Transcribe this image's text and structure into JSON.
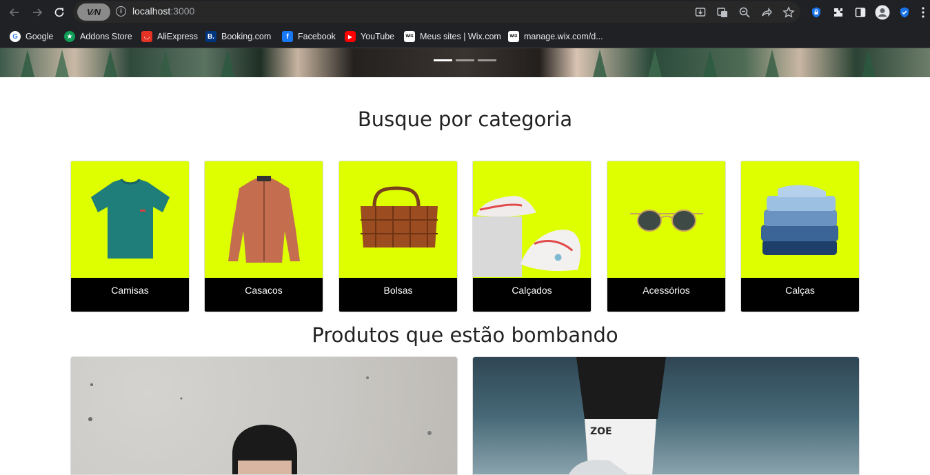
{
  "browser": {
    "url_host": "localhost",
    "url_port": ":3000",
    "vpn_label": "V⁄N",
    "bookmarks": [
      {
        "label": "Google",
        "icon": "google-icon",
        "color": "#ffffff"
      },
      {
        "label": "Addons Store",
        "icon": "addons-store-icon",
        "color": "#0f9d58"
      },
      {
        "label": "AliExpress",
        "icon": "aliexpress-icon",
        "color": "#e43225"
      },
      {
        "label": "Booking.com",
        "icon": "booking-icon",
        "color": "#003580"
      },
      {
        "label": "Facebook",
        "icon": "facebook-icon",
        "color": "#1877f2"
      },
      {
        "label": "YouTube",
        "icon": "youtube-icon",
        "color": "#ff0000"
      },
      {
        "label": "Meus sites | Wix.com",
        "icon": "wix-icon",
        "color": "#ffffff"
      },
      {
        "label": "manage.wix.com/d...",
        "icon": "wix-icon",
        "color": "#ffffff"
      }
    ]
  },
  "page": {
    "carousel": {
      "slides": 3,
      "active": 0
    },
    "category_title": "Busque por categoria",
    "categories": [
      {
        "label": "Camisas",
        "icon": "tshirt-image"
      },
      {
        "label": "Casacos",
        "icon": "jacket-image"
      },
      {
        "label": "Bolsas",
        "icon": "handbag-image"
      },
      {
        "label": "Calçados",
        "icon": "sneakers-image"
      },
      {
        "label": "Acessórios",
        "icon": "sunglasses-image"
      },
      {
        "label": "Calças",
        "icon": "jeans-image"
      }
    ],
    "trending_title": "Produtos que estão bombando",
    "colors": {
      "accent": "#ddff00",
      "label_bg": "#000000"
    }
  }
}
